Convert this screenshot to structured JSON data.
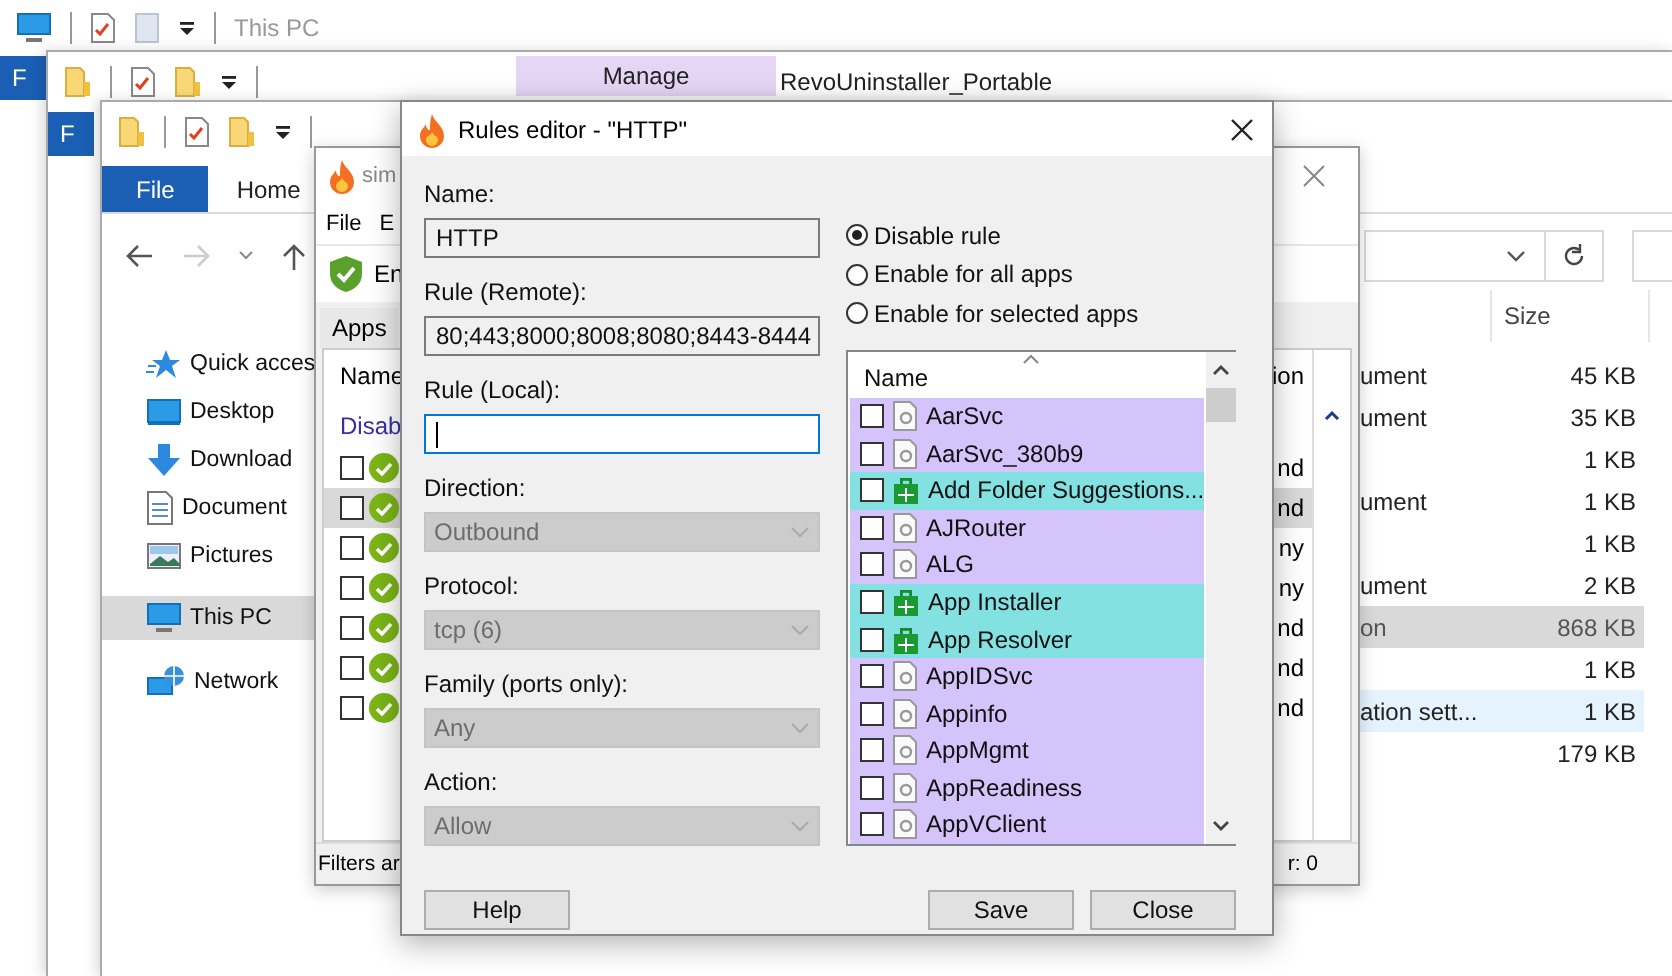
{
  "back_windows": [
    {
      "title": "This PC",
      "file_tab": "F"
    },
    {
      "context_tab": "Manage",
      "title": "RevoUninstaller_Portable",
      "file_tab": "F"
    }
  ],
  "explorer": {
    "ribbon_tabs": [
      {
        "label": "File",
        "selected": true
      },
      {
        "label": "Home",
        "selected": false
      }
    ],
    "nav_items": [
      {
        "label": "Quick acces",
        "kind": "quickaccess",
        "selected": false
      },
      {
        "label": "Desktop",
        "kind": "desktop",
        "selected": false
      },
      {
        "label": "Download",
        "kind": "downloads",
        "selected": false
      },
      {
        "label": "Document",
        "kind": "documents",
        "selected": false
      },
      {
        "label": "Pictures",
        "kind": "pictures",
        "selected": false
      },
      {
        "label": "This PC",
        "kind": "computer",
        "selected": true
      },
      {
        "label": "Network",
        "kind": "network",
        "selected": false
      }
    ],
    "size_column": "Size",
    "rows": [
      {
        "type": "ument",
        "size": "45 KB",
        "selected": false,
        "hovered": false
      },
      {
        "type": "ument",
        "size": "35 KB",
        "selected": false,
        "hovered": false
      },
      {
        "size": "1 KB",
        "selected": false,
        "hovered": false
      },
      {
        "type": "ument",
        "size": "1 KB",
        "selected": false,
        "hovered": false
      },
      {
        "size": "1 KB",
        "selected": false,
        "hovered": false
      },
      {
        "type": "ument",
        "size": "2 KB",
        "selected": false,
        "hovered": false
      },
      {
        "type": "on",
        "size": "868 KB",
        "selected": true,
        "hovered": false
      },
      {
        "size": "1 KB",
        "selected": false,
        "hovered": false
      },
      {
        "type": "ation sett...",
        "size": "1 KB",
        "selected": false,
        "hovered": true
      },
      {
        "size": "179 KB",
        "selected": false,
        "hovered": false
      }
    ]
  },
  "simplewall": {
    "title": "sim",
    "menu": [
      "File",
      "E"
    ],
    "toolbar_label": "En",
    "tab": "Apps",
    "name_column": "Name",
    "right_column": "ion",
    "group": "Disab",
    "rows": [
      {
        "checked": false,
        "right": "nd",
        "selected": false
      },
      {
        "checked": false,
        "right": "nd",
        "selected": true
      },
      {
        "checked": false,
        "right": "ny",
        "selected": false
      },
      {
        "checked": false,
        "right": "ny",
        "selected": false
      },
      {
        "checked": false,
        "right": "nd",
        "selected": false
      },
      {
        "checked": false,
        "right": "nd",
        "selected": false
      },
      {
        "checked": false,
        "right": "nd",
        "selected": false
      }
    ],
    "status_left": "Filters ar",
    "status_right": "r: 0"
  },
  "dialog": {
    "title": "Rules editor - \"HTTP\"",
    "fields": [
      {
        "label": "Name:",
        "kind": "text",
        "value": "HTTP",
        "focused": false
      },
      {
        "label": "Rule (Remote):",
        "kind": "text",
        "value": "80;443;8000;8008;8080;8443-8444",
        "focused": false
      },
      {
        "label": "Rule (Local):",
        "kind": "text",
        "focused": true
      },
      {
        "label": "Direction:",
        "kind": "dropdown",
        "value": "Outbound",
        "disabled": true
      },
      {
        "label": "Protocol:",
        "kind": "dropdown",
        "value": "tcp (6)",
        "disabled": true
      },
      {
        "label": "Family (ports only):",
        "kind": "dropdown",
        "value": "Any",
        "disabled": true
      },
      {
        "label": "Action:",
        "kind": "dropdown",
        "value": "Allow",
        "disabled": true
      }
    ],
    "radios": [
      {
        "label": "Disable rule",
        "selected": true
      },
      {
        "label": "Enable for all apps",
        "selected": false
      },
      {
        "label": "Enable for selected apps",
        "selected": false
      }
    ],
    "apps_column": "Name",
    "apps": [
      {
        "name": "AarSvc",
        "kind": "service",
        "checked": false,
        "color": "#d4c4fb"
      },
      {
        "name": "AarSvc_380b9",
        "kind": "service",
        "checked": false,
        "color": "#d4c4fb"
      },
      {
        "name": "Add Folder Suggestions...",
        "kind": "store",
        "checked": false,
        "color": "#84e1e1"
      },
      {
        "name": "AJRouter",
        "kind": "service",
        "checked": false,
        "color": "#d4c4fb"
      },
      {
        "name": "ALG",
        "kind": "service",
        "checked": false,
        "color": "#d4c4fb"
      },
      {
        "name": "App Installer",
        "kind": "store",
        "checked": false,
        "color": "#84e1e1"
      },
      {
        "name": "App Resolver",
        "kind": "store",
        "checked": false,
        "color": "#84e1e1"
      },
      {
        "name": "AppIDSvc",
        "kind": "service",
        "checked": false,
        "color": "#d4c4fb"
      },
      {
        "name": "Appinfo",
        "kind": "service",
        "checked": false,
        "color": "#d4c4fb"
      },
      {
        "name": "AppMgmt",
        "kind": "service",
        "checked": false,
        "color": "#d4c4fb"
      },
      {
        "name": "AppReadiness",
        "kind": "service",
        "checked": false,
        "color": "#d4c4fb"
      },
      {
        "name": "AppVClient",
        "kind": "service",
        "checked": false,
        "color": "#d4c4fb"
      }
    ],
    "buttons": [
      {
        "label": "Help",
        "kind": "left"
      },
      {
        "label": "Save",
        "kind": "right"
      },
      {
        "label": "Close",
        "kind": "right"
      }
    ]
  }
}
